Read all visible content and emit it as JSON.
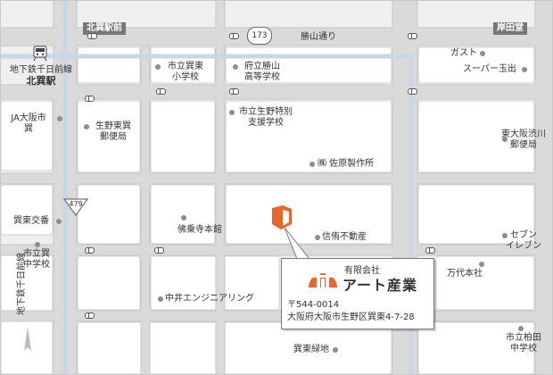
{
  "colors": {
    "road": "#d9d9d9",
    "road_edge": "#c4c4c4",
    "block": "#ffffff",
    "rail": "#c9d6e6",
    "accent": "#e8662a",
    "tag_bg": "#777777"
  },
  "roads": {
    "kita_tatsumi_ekimae": "北巽駅前",
    "kishidado": "岸田堂",
    "katsuyama_dori": "勝山通り",
    "route_173": "173",
    "route_479": "479"
  },
  "rail": {
    "line_vertical": "地下鉄千日前線",
    "station_label_line": "地下鉄千日前線",
    "station_label_name": "北巽駅"
  },
  "landmarks": {
    "gasuto": "ガスト",
    "super_tamade": "スーパー玉出",
    "tatsumi_higashi_elem_1": "市立巽東",
    "tatsumi_higashi_elem_2": "小学校",
    "katsuyama_high_1": "府立勝山",
    "katsuyama_high_2": "高等学校",
    "ja_1": "JA大阪市",
    "ja_2": "巽",
    "ikuno_post_1": "生野東巽",
    "ikuno_post_2": "郵便局",
    "ikuno_special_1": "市立生野特別",
    "ikuno_special_2": "支援学校",
    "higashiosaka_post_1": "東大阪渋川",
    "higashiosaka_post_2": "郵便局",
    "sahara": "㈱ 佐原製作所",
    "tatsumi_higashi_crossing": "巽東交番",
    "tatsumi_junior_1": "市立巽",
    "tatsumi_junior_2": "中学校",
    "butsujoji": "佛乗寺本館",
    "shinyu": "信侑不動産",
    "seven_1": "セブン",
    "seven_2": "イレブン",
    "mandai": "万代本社",
    "nakai": "中井エンジニアリング",
    "tatsumi_green": "巽東緑地",
    "kashiwada_junior_1": "市立柏田",
    "kashiwada_junior_2": "中学校"
  },
  "company": {
    "type": "有限会社",
    "name": "アート産業",
    "postal": "〒544-0014",
    "address": "大阪府大阪市生野区巽東4-7-28"
  }
}
